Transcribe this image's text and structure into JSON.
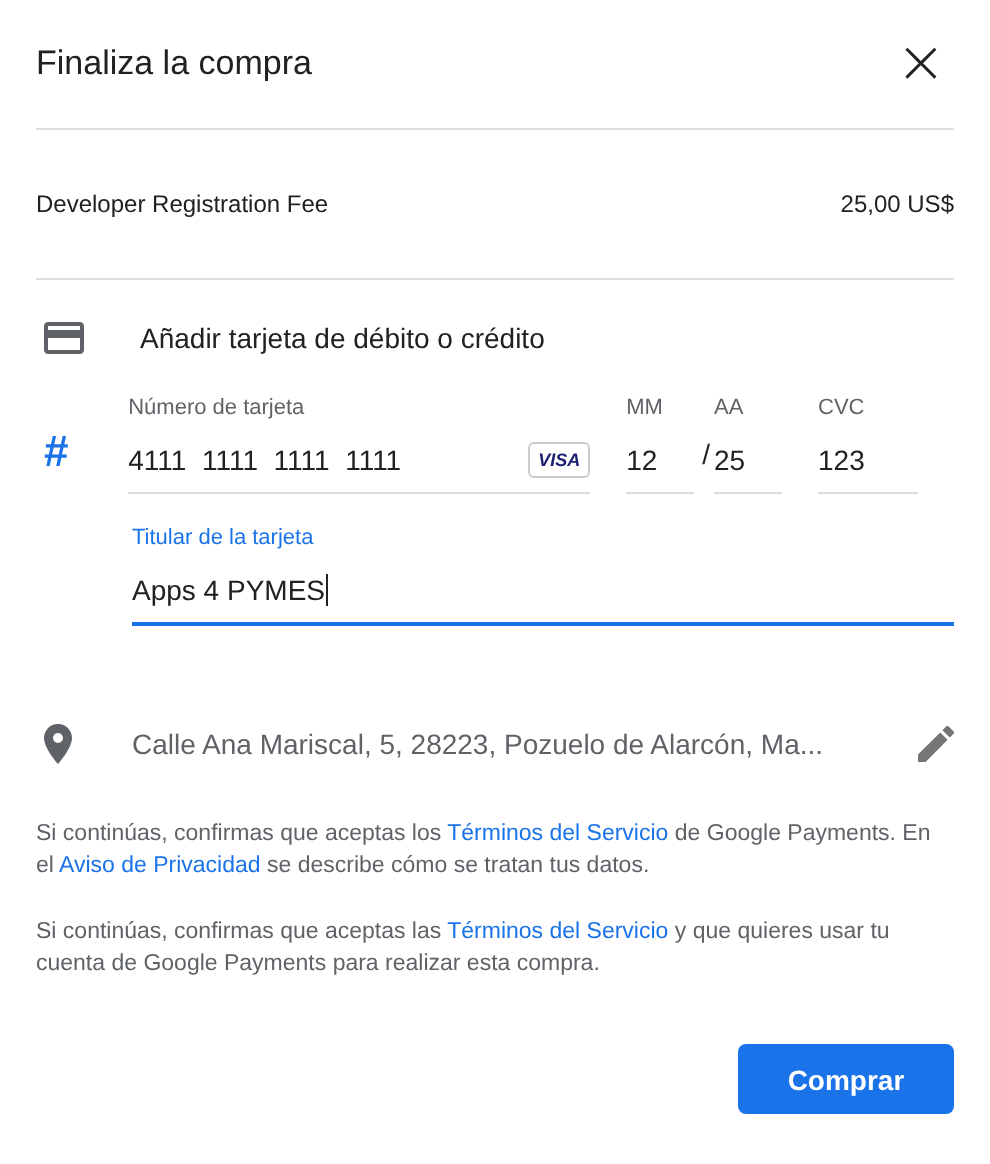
{
  "dialog": {
    "title": "Finaliza la compra",
    "close": "×"
  },
  "item": {
    "name": "Developer Registration Fee",
    "price": "25,00 US$"
  },
  "payment": {
    "heading": "Añadir tarjeta de débito o crédito",
    "number_icon": "#",
    "fields": [
      {
        "kind": "card",
        "label": "Número de tarjeta",
        "value": "4111  1111  1111  1111",
        "brand": "VISA",
        "focused": false
      },
      {
        "kind": "mm",
        "label": "MM",
        "value": "12",
        "focused": false
      },
      {
        "kind": "aa",
        "label": "AA",
        "value": "25",
        "separator": "/",
        "focused": false
      },
      {
        "kind": "cvc",
        "label": "CVC",
        "value": "123",
        "focused": false
      }
    ],
    "holder": {
      "label": "Titular de la tarjeta",
      "value": "Apps 4 PYMES",
      "focused": true
    }
  },
  "address": "Calle Ana Mariscal, 5, 28223, Pozuelo de Alarcón, Ma...",
  "legal": [
    [
      {
        "kind": "text",
        "text": "Si continúas, confirmas que aceptas los "
      },
      {
        "kind": "link",
        "text": "Términos del Servicio"
      },
      {
        "kind": "text",
        "text": " de Google Payments. En el "
      },
      {
        "kind": "link",
        "text": "Aviso de Privacidad"
      },
      {
        "kind": "text",
        "text": " se describe cómo se tratan tus datos."
      }
    ],
    [
      {
        "kind": "text",
        "text": "Si continúas, confirmas que aceptas las "
      },
      {
        "kind": "link",
        "text": "Términos del Servicio"
      },
      {
        "kind": "text",
        "text": " y que quieres usar tu cuenta de Google Payments para realizar esta compra."
      }
    ]
  ],
  "buy_button": "Comprar"
}
